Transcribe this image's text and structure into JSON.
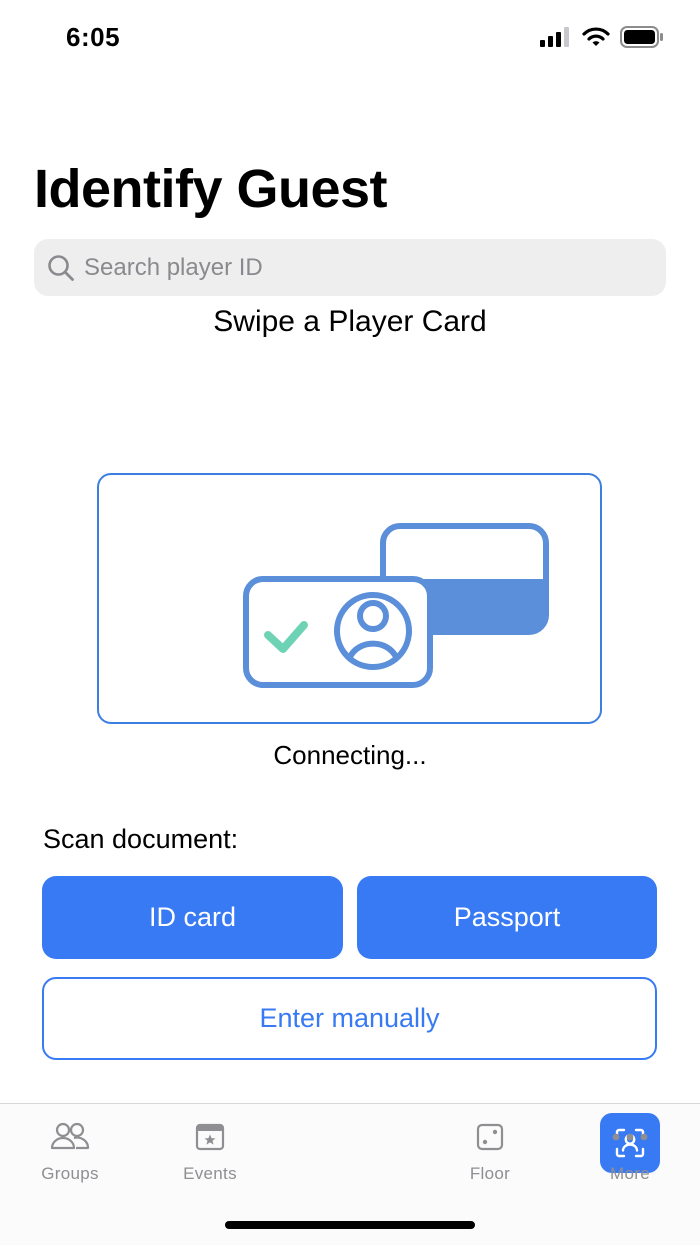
{
  "status_bar": {
    "time": "6:05"
  },
  "page": {
    "title": "Identify Guest"
  },
  "search": {
    "placeholder": "Search player ID"
  },
  "swipe": {
    "heading": "Swipe a Player Card",
    "status": "Connecting..."
  },
  "scan": {
    "label": "Scan document:",
    "id_card_label": "ID card",
    "passport_label": "Passport",
    "manual_label": "Enter manually"
  },
  "tabs": [
    {
      "label": "Groups",
      "icon": "groups-icon"
    },
    {
      "label": "Events",
      "icon": "events-icon"
    },
    {
      "label": "",
      "icon": "identify-guest-icon",
      "active": true
    },
    {
      "label": "Floor",
      "icon": "dice-icon"
    },
    {
      "label": "More",
      "icon": "more-icon"
    }
  ],
  "colors": {
    "accent": "#387af3",
    "illustration": "#5b8fd9",
    "check": "#6ed3b4",
    "search_bg": "#eeeeef",
    "tab_inactive": "#8e8e93"
  }
}
